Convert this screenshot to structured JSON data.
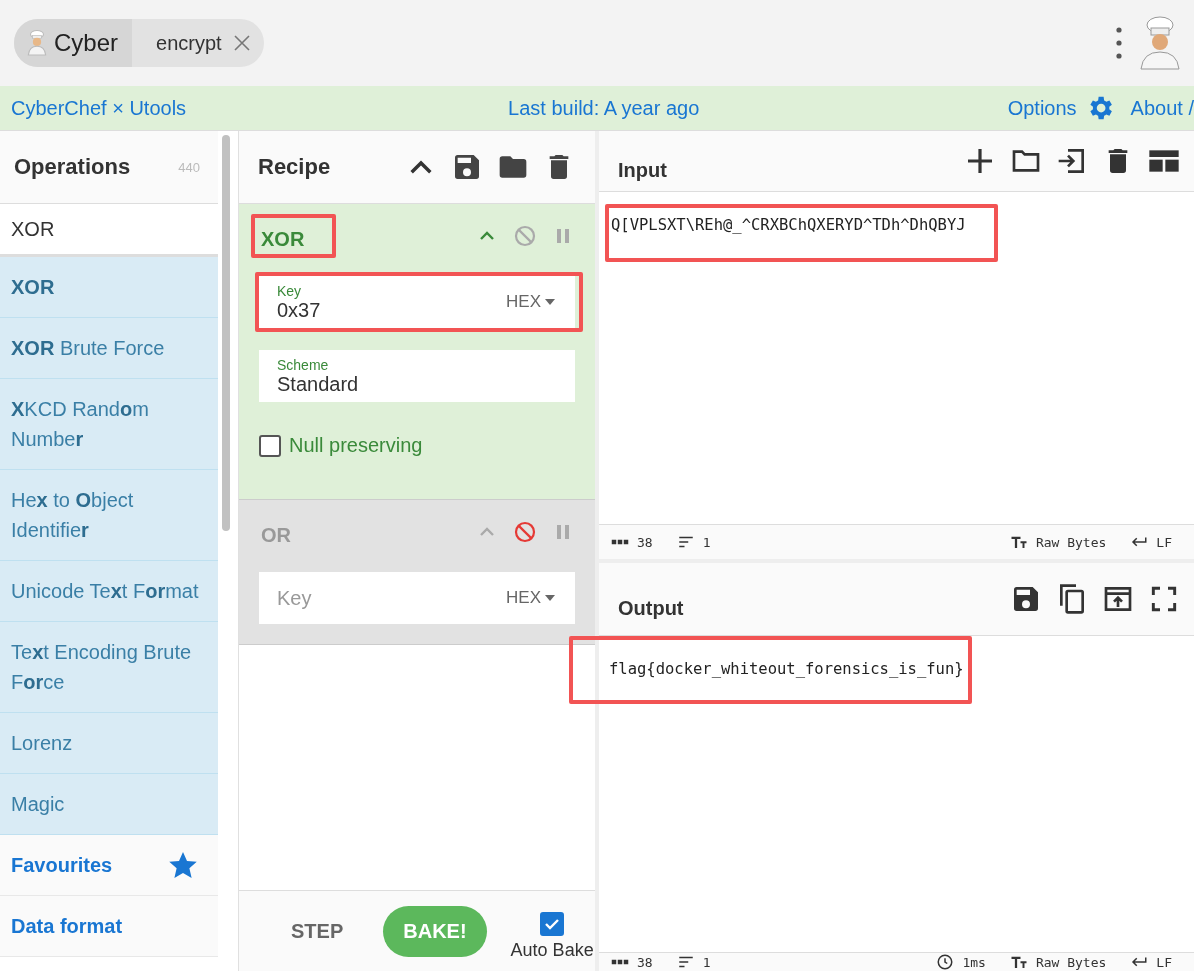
{
  "tab": {
    "app": "Cyber",
    "title": "encrypt"
  },
  "banner": {
    "brand": "CyberChef × Utools",
    "build": "Last build: A year ago",
    "options": "Options",
    "about": "About /"
  },
  "operations": {
    "title": "Operations",
    "count": "440",
    "search": "XOR",
    "results": [
      {
        "label": "**XOR**"
      },
      {
        "label": "**XOR** Brute Force"
      },
      {
        "label": "**X**KCD Rand**o**m Numbe**r**"
      },
      {
        "label": "He**x** to **O**bject Identifie**r**"
      },
      {
        "label": "Unicode Te**x**t F**or**mat"
      },
      {
        "label": "Te**x**t Encoding Brute F**or**ce"
      },
      {
        "label": "Lorenz"
      },
      {
        "label": "Magic"
      }
    ],
    "categories": [
      {
        "label": "Favourites",
        "starred": true
      },
      {
        "label": "Data format",
        "starred": false
      }
    ]
  },
  "recipe": {
    "title": "Recipe",
    "ops": [
      {
        "name": "XOR",
        "disabled": false,
        "highlighted": true,
        "args": [
          {
            "kind": "field",
            "label": "Key",
            "value": "0x37",
            "type": "HEX",
            "highlighted": true
          },
          {
            "kind": "field",
            "label": "Scheme",
            "value": "Standard",
            "highlighted": false
          },
          {
            "kind": "checkbox",
            "label": "Null preserving",
            "checked": false
          }
        ]
      },
      {
        "name": "OR",
        "disabled": true,
        "highlighted": false,
        "args": [
          {
            "kind": "field",
            "placeholder": "Key",
            "type": "HEX",
            "highlighted": false
          }
        ]
      }
    ],
    "step": "STEP",
    "bake": "BAKE!",
    "auto_bake": {
      "label": "Auto Bake",
      "checked": true
    }
  },
  "input": {
    "title": "Input",
    "value": "Q[VPLSXT\\REh@_^CRXBChQXERYD^TDh^DhQBYJ",
    "highlighted": true,
    "status": {
      "chars": "38",
      "lines": "1",
      "encoding": "Raw Bytes",
      "eol": "LF"
    }
  },
  "output": {
    "title": "Output",
    "value": "flag{docker_whiteout_forensics_is_fun}",
    "highlighted": true,
    "status": {
      "chars": "38",
      "lines": "1",
      "time": "1ms",
      "encoding": "Raw Bytes",
      "eol": "LF"
    }
  }
}
